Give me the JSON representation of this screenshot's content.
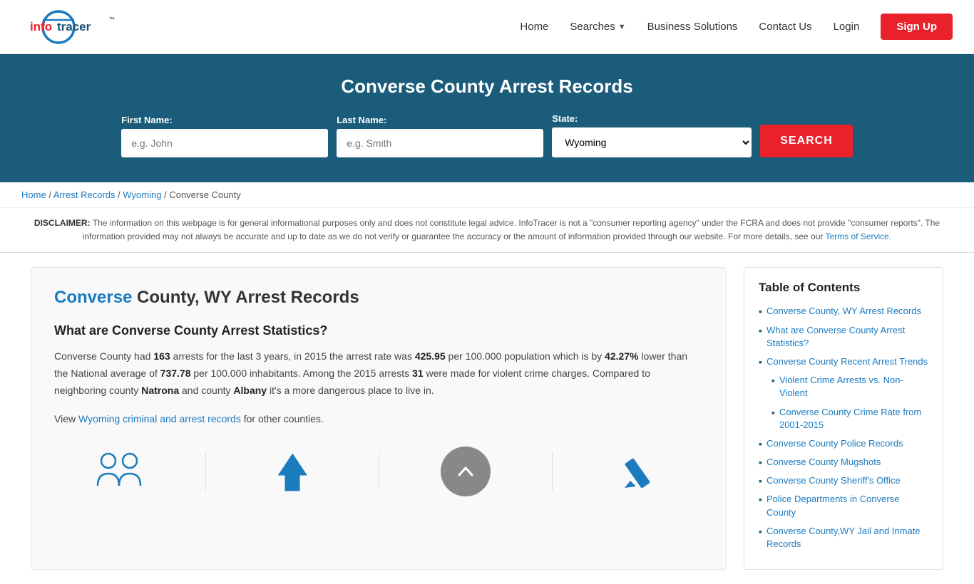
{
  "header": {
    "logo_text_info": "info",
    "logo_text_tracer": "Tracer",
    "nav": {
      "home": "Home",
      "searches": "Searches",
      "business_solutions": "Business Solutions",
      "contact_us": "Contact Us",
      "login": "Login",
      "signup": "Sign Up"
    }
  },
  "hero": {
    "title": "Converse County Arrest Records",
    "form": {
      "first_name_label": "First Name:",
      "first_name_placeholder": "e.g. John",
      "last_name_label": "Last Name:",
      "last_name_placeholder": "e.g. Smith",
      "state_label": "State:",
      "state_value": "Wyoming",
      "search_button": "SEARCH"
    }
  },
  "breadcrumb": {
    "home": "Home",
    "arrest_records": "Arrest Records",
    "wyoming": "Wyoming",
    "county": "Converse County",
    "separator": "/"
  },
  "disclaimer": {
    "label": "DISCLAIMER:",
    "text": "The information on this webpage is for general informational purposes only and does not constitute legal advice. InfoTracer is not a \"consumer reporting agency\" under the FCRA and does not provide \"consumer reports\". The information provided may not always be accurate and up to date as we do not verify or guarantee the accuracy or the amount of information provided through our website. For more details, see our",
    "link_text": "Terms of Service",
    "period": "."
  },
  "article": {
    "title_highlight": "Converse",
    "title_rest": " County, WY Arrest Records",
    "section_heading": "What are Converse County Arrest Statistics?",
    "paragraph1_pre": "Converse County had ",
    "paragraph1_num1": "163",
    "paragraph1_mid1": " arrests for the last 3 years, in 2015 the arrest rate was ",
    "paragraph1_num2": "425.95",
    "paragraph1_mid2": " per 100.000 population which is by ",
    "paragraph1_num3": "42.27%",
    "paragraph1_mid3": " lower than the National average of ",
    "paragraph1_num4": "737.78",
    "paragraph1_mid4": " per 100.000 inhabitants. Among the 2015 arrests ",
    "paragraph1_num5": "31",
    "paragraph1_mid5": " were made for violent crime charges. Compared to neighboring county ",
    "paragraph1_county1": "Natrona",
    "paragraph1_mid6": " and county ",
    "paragraph1_county2": "Albany",
    "paragraph1_end": " it's a more dangerous place to live in.",
    "paragraph2_pre": "View ",
    "paragraph2_link_text": "Wyoming criminal and arrest records",
    "paragraph2_post": " for other counties."
  },
  "toc": {
    "title": "Table of Contents",
    "items": [
      {
        "text": "Converse County, WY Arrest Records",
        "sub": false
      },
      {
        "text": "What are Converse County Arrest Statistics?",
        "sub": false
      },
      {
        "text": "Converse County Recent Arrest Trends",
        "sub": false
      },
      {
        "text": "Violent Crime Arrests vs. Non-Violent",
        "sub": true
      },
      {
        "text": "Converse County Crime Rate from 2001-2015",
        "sub": true
      },
      {
        "text": "Converse County Police Records",
        "sub": false
      },
      {
        "text": "Converse County Mugshots",
        "sub": false
      },
      {
        "text": "Converse County Sheriff's Office",
        "sub": false
      },
      {
        "text": "Police Departments in Converse County",
        "sub": false
      },
      {
        "text": "Converse County,WY Jail and Inmate Records",
        "sub": false
      }
    ]
  }
}
